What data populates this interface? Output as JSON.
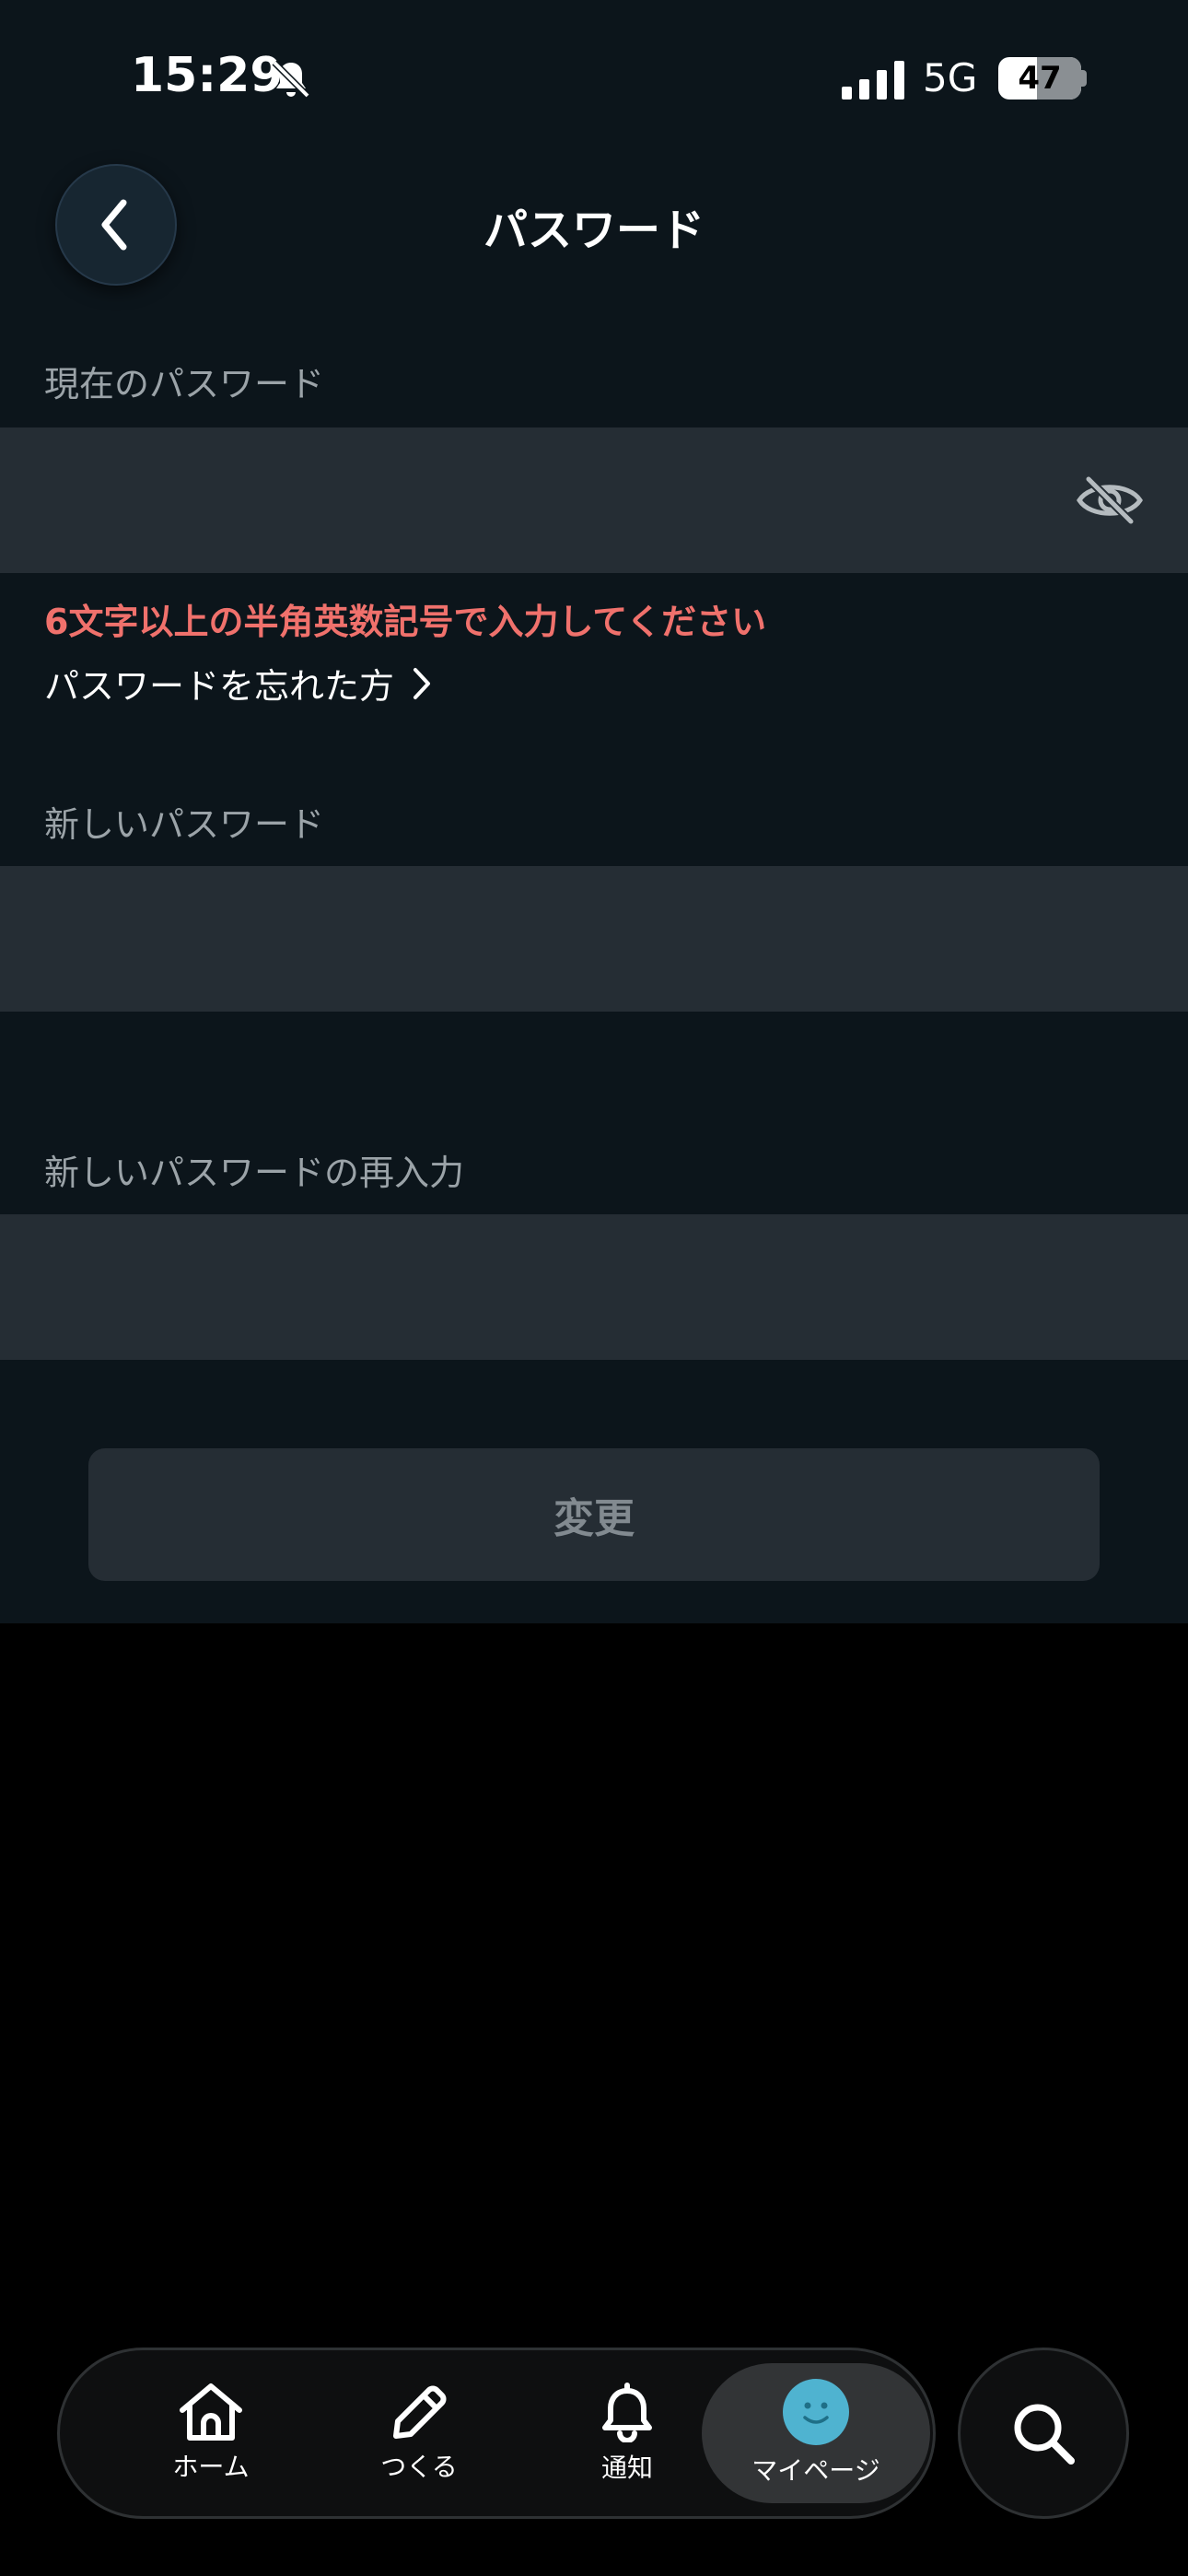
{
  "status_bar": {
    "time": "15:29",
    "network": "5G",
    "battery_percent": "47",
    "battery_level": 0.47,
    "icons": [
      "bell-off-icon",
      "signal-icon",
      "battery-icon"
    ]
  },
  "header": {
    "title": "パスワード",
    "back_icon": "chevron-left-icon"
  },
  "form": {
    "current_password": {
      "label": "現在のパスワード",
      "value": "",
      "icon": "eye-off-icon"
    },
    "error_message": "6文字以上の半角英数記号で入力してください",
    "forgot_link": "パスワードを忘れた方",
    "new_password": {
      "label": "新しいパスワード",
      "value": ""
    },
    "confirm_password": {
      "label": "新しいパスワードの再入力",
      "value": ""
    },
    "submit_label": "変更"
  },
  "tab_bar": {
    "items": [
      {
        "label": "ホーム",
        "icon": "home-icon"
      },
      {
        "label": "つくる",
        "icon": "pencil-icon"
      },
      {
        "label": "通知",
        "icon": "bell-icon"
      },
      {
        "label": "マイページ",
        "icon": "avatar-icon",
        "active": true
      }
    ],
    "search_icon": "search-icon"
  },
  "colors": {
    "background": "#0c151b",
    "input_background": "#252d34",
    "error": "#f0716c",
    "avatar": "#4fb3d0"
  }
}
